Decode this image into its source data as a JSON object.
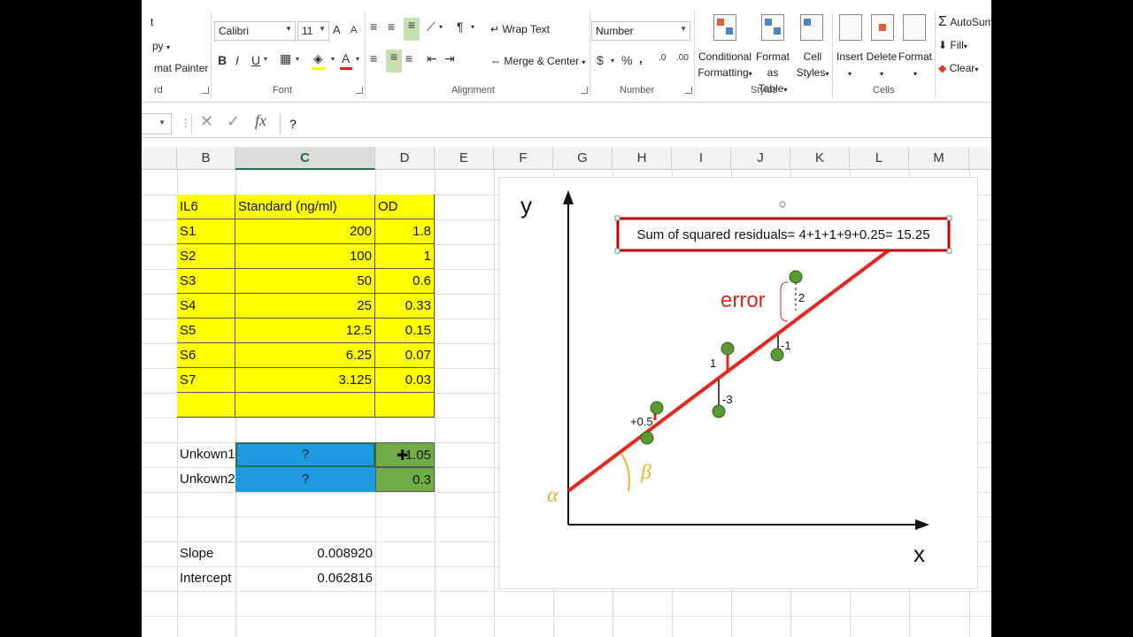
{
  "clipboard": {
    "copy": "py",
    "format_painter": "mat Painter",
    "group": "rd",
    "cut": "t"
  },
  "font": {
    "name": "Calibri",
    "size": "11",
    "bold": "B",
    "italic": "I",
    "underline": "U",
    "grow": "A",
    "shrink": "A",
    "group": "Font"
  },
  "alignment": {
    "wrap_text": "Wrap Text",
    "merge_center": "Merge & Center",
    "group": "Alignment"
  },
  "number": {
    "format": "Number",
    "currency": "$",
    "percent": "%",
    "comma": ",",
    "group": "Number"
  },
  "styles": {
    "conditional": "Conditional",
    "formatting": "Formatting",
    "format_as": "Format as",
    "table": "Table",
    "cell": "Cell",
    "cell_styles": "Styles",
    "group": "Styles"
  },
  "cells": {
    "insert": "Insert",
    "delete": "Delete",
    "format": "Format",
    "group": "Cells"
  },
  "editing": {
    "autosum": "AutoSum",
    "fill": "Fill",
    "clear": "Clear"
  },
  "formula_bar": {
    "fx": "fx",
    "value": "?"
  },
  "columns": [
    "B",
    "C",
    "D",
    "E",
    "F",
    "G",
    "H",
    "I",
    "J",
    "K",
    "L",
    "M"
  ],
  "table": {
    "header": {
      "id": "IL6",
      "std": "Standard (ng/ml)",
      "od": "OD"
    },
    "rows": [
      {
        "id": "S1",
        "std": "200",
        "od": "1.8"
      },
      {
        "id": "S2",
        "std": "100",
        "od": "1"
      },
      {
        "id": "S3",
        "std": "50",
        "od": "0.6"
      },
      {
        "id": "S4",
        "std": "25",
        "od": "0.33"
      },
      {
        "id": "S5",
        "std": "12.5",
        "od": "0.15"
      },
      {
        "id": "S6",
        "std": "6.25",
        "od": "0.07"
      },
      {
        "id": "S7",
        "std": "3.125",
        "od": "0.03"
      }
    ]
  },
  "unknowns": [
    {
      "label": "Unkown1",
      "std": "?",
      "od": "1.05"
    },
    {
      "label": "Unkown2",
      "std": "?",
      "od": "0.3"
    }
  ],
  "stats": {
    "slope_label": "Slope",
    "slope": "0.008920",
    "intercept_label": "Intercept",
    "intercept": "0.062816"
  },
  "diagram": {
    "y_axis": "y",
    "x_axis": "x",
    "textbox": "Sum of squared residuals= 4+1+1+9+0.25= 15.25",
    "error_label": "error",
    "alpha": "α",
    "beta": "β",
    "residual_labels": [
      "+0.5",
      "1",
      "-3",
      "-1",
      "2"
    ],
    "colors": {
      "line": "#e8261e",
      "point": "#5b9a32",
      "greek": "#f0b429",
      "axis": "#111111"
    }
  }
}
